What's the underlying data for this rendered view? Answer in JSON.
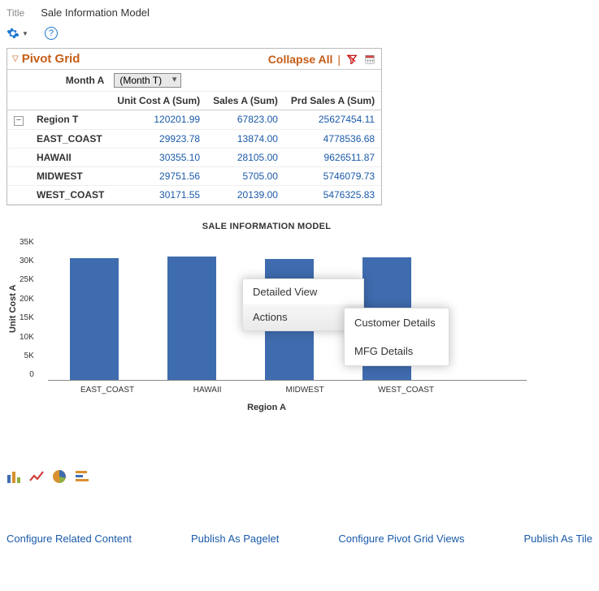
{
  "header": {
    "title_label": "Title",
    "title_value": "Sale Information Model"
  },
  "pivot": {
    "title": "Pivot Grid",
    "collapse_label": "Collapse All",
    "filter_label": "Month A",
    "filter_value": "(Month T)",
    "columns": [
      "Unit Cost A (Sum)",
      "Sales A (Sum)",
      "Prd Sales A (Sum)"
    ],
    "total_row_label": "Region T",
    "totals": [
      "120201.99",
      "67823.00",
      "25627454.11"
    ],
    "rows": [
      {
        "label": "EAST_COAST",
        "vals": [
          "29923.78",
          "13874.00",
          "4778536.68"
        ]
      },
      {
        "label": "HAWAII",
        "vals": [
          "30355.10",
          "28105.00",
          "9626511.87"
        ]
      },
      {
        "label": "MIDWEST",
        "vals": [
          "29751.56",
          "5705.00",
          "5746079.73"
        ]
      },
      {
        "label": "WEST_COAST",
        "vals": [
          "30171.55",
          "20139.00",
          "5476325.83"
        ]
      }
    ]
  },
  "chart_data": {
    "type": "bar",
    "title": "SALE INFORMATION MODEL",
    "xlabel": "Region A",
    "ylabel": "Unit Cost A",
    "ylim": [
      0,
      35000
    ],
    "yticks": [
      "35K",
      "30K",
      "25K",
      "20K",
      "15K",
      "10K",
      "5K",
      "0"
    ],
    "categories": [
      "EAST_COAST",
      "HAWAII",
      "MIDWEST",
      "WEST_COAST"
    ],
    "values": [
      29923.78,
      30355.1,
      29751.56,
      30171.55
    ]
  },
  "context_menu": {
    "items": [
      "Detailed View",
      "Actions"
    ],
    "actions_sub": [
      "Customer Details",
      "MFG Details"
    ]
  },
  "footer": {
    "links": [
      "Configure Related Content",
      "Publish As Pagelet",
      "Configure Pivot Grid Views",
      "Publish As Tile"
    ]
  }
}
